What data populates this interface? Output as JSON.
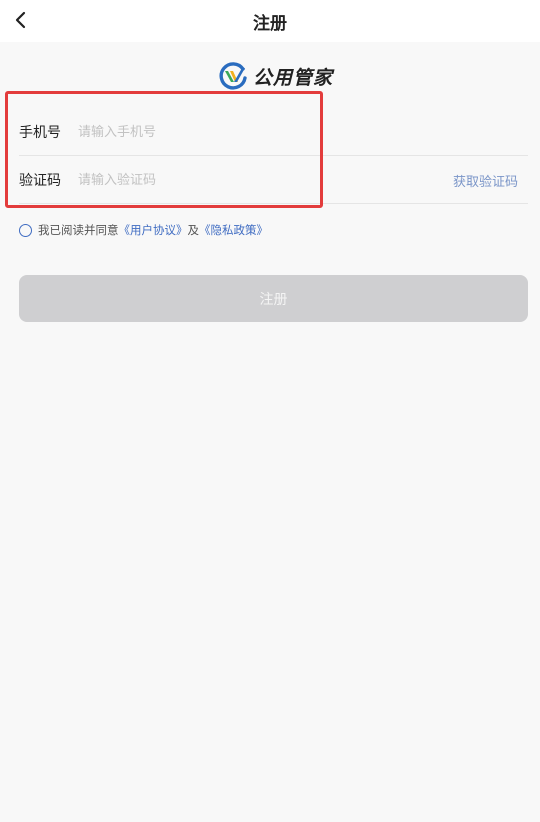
{
  "nav": {
    "back_icon": "chevron-left-icon",
    "title": "注册"
  },
  "brand": {
    "logo_icon": "brand-logo-icon",
    "name": "公用管家",
    "colors": {
      "blue": "#2a6cbf",
      "yellow": "#f2b01e",
      "green": "#3aa858"
    }
  },
  "form": {
    "phone": {
      "label": "手机号",
      "placeholder": "请输入手机号",
      "value": ""
    },
    "code": {
      "label": "验证码",
      "placeholder": "请输入验证码",
      "value": "",
      "get_code_label": "获取验证码"
    }
  },
  "agreement": {
    "checked": false,
    "prefix": "我已阅读并同意",
    "user_agreement": "《用户协议》",
    "conjunction": "及",
    "privacy_policy": "《隐私政策》"
  },
  "submit": {
    "label": "注册"
  },
  "colors": {
    "accent": "#3f6cc2",
    "link_muted": "#7a95c8",
    "highlight": "#e33c3c",
    "button_disabled": "#cfcfd1",
    "background": "#f8f8f8"
  }
}
